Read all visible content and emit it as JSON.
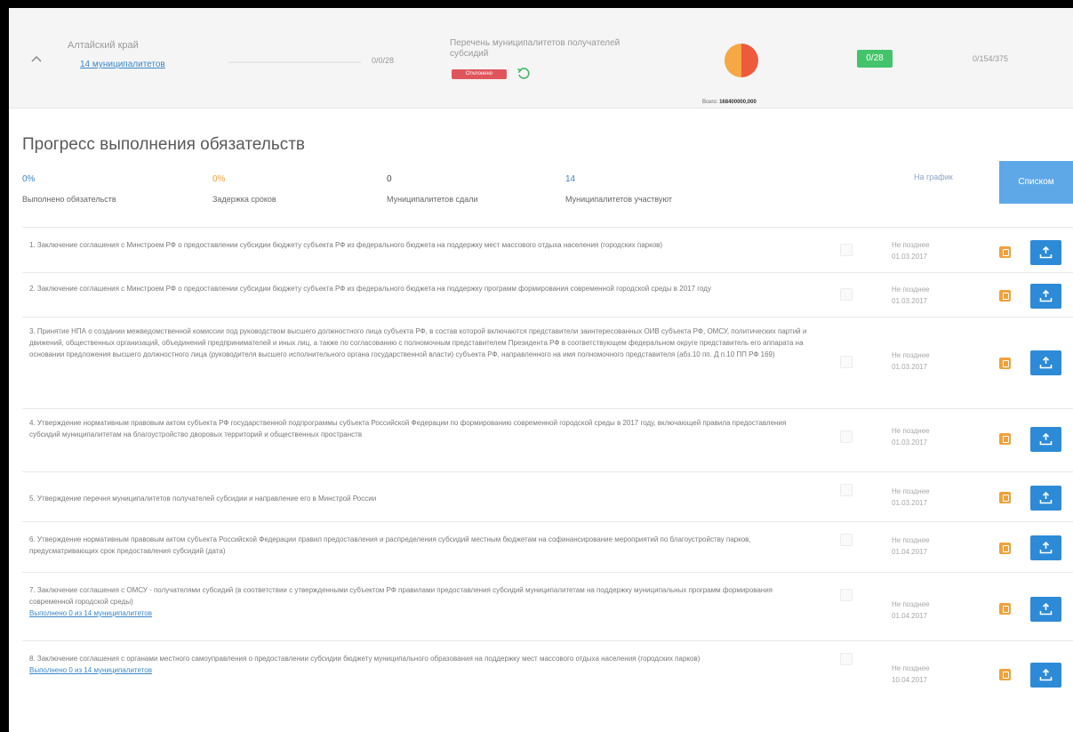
{
  "region": {
    "name": "Алтайский край",
    "municipalities_link": "14 муниципалитетов",
    "fraction": "0/0/28",
    "list_title": "Перечень муниципалитетов получателей субсидий",
    "status_badge": "Отклонено",
    "total_label": "Всего:",
    "total_value": "168400000,000",
    "percent_badge": "0/28",
    "amount": "0/154/375",
    "donut_colors": [
      "#f5a843",
      "#ee5a3c"
    ],
    "collapse_icon": "chevron-up-icon"
  },
  "progress": {
    "title": "Прогресс выполнения обязательств",
    "stats": [
      {
        "value": "0%",
        "label": "Выполнено обязательств",
        "color": "#3a87c8"
      },
      {
        "value": "0%",
        "label": "Задержка сроков",
        "color": "#f0a13b"
      },
      {
        "value": "0",
        "label": "Муниципалитетов сдали",
        "color": "#444444"
      },
      {
        "value": "14",
        "label": "Муниципалитетов участвуют",
        "color": "#3a87c8"
      }
    ],
    "chart_link": "На график",
    "list_button": "Списком"
  },
  "obligations": [
    {
      "text": "1. Заключение соглашения с Минстроем РФ о предоставлении субсидии бюджету субъекта РФ из федерального бюджета на поддержку мест массового отдыха населения (городских парков)",
      "link": "",
      "deadline_label": "Не позднее",
      "deadline_date": "01.03.2017"
    },
    {
      "text": "2. Заключение соглашения с Минстроем РФ о предоставлении субсидии бюджету субъекта РФ из федерального бюджета на поддержку программ формирования современной городской среды в 2017 году",
      "link": "",
      "deadline_label": "Не позднее",
      "deadline_date": "01.03.2017"
    },
    {
      "text": "3. Принятие НПА о создании межведомственной комиссии под руководством высшего должностного лица субъекта РФ, в состав которой включаются представители заинтересованных ОИВ субъекта РФ, ОМСУ, политических партий и движений, общественных организаций, объединений предпринимателей и иных лиц, а также по согласованию с полномочным представителем Президента РФ в соответствующем федеральном округе представитель его аппарата на основании предложения высшего должностного лица (руководителя высшего исполнительного органа государственной власти) субъекта РФ, направленного на имя полномочного представителя (абз.10 пп. Д п.10 ПП РФ 169)",
      "link": "",
      "deadline_label": "Не позднее",
      "deadline_date": "01.03.2017"
    },
    {
      "text": "4. Утверждение нормативным правовым актом субъекта РФ государственной подпрограммы субъекта Российской Федерации по формированию современной городской среды в 2017 году, включающей правила предоставления субсидий муниципалитетам на благоустройство дворовых территорий и общественных пространств",
      "link": "",
      "deadline_label": "Не позднее",
      "deadline_date": "01.03.2017"
    },
    {
      "text": "5. Утверждение перечня муниципалитетов получателей субсидии и направление его в Минстрой России",
      "link": "",
      "deadline_label": "Не позднее",
      "deadline_date": "01.03.2017"
    },
    {
      "text": "6. Утверждение нормативным правовым актом субъекта Российской Федерации правил предоставления и распределения субсидий местным бюджетам на софинансирование мероприятий по благоустройству парков, предусматривающих срок предоставления субсидий (дата)",
      "link": "",
      "deadline_label": "Не позднее",
      "deadline_date": "01.04.2017"
    },
    {
      "text": "7. Заключение соглашения с ОМСУ - получателями субсидий (в соответствии с утвержденными субъектом РФ правилами предоставления субсидий муниципалитетам на поддержку муниципальных программ формирования современной городской среды)",
      "link": "Выполнено 0 из 14 муниципалитетов",
      "deadline_label": "Не позднее",
      "deadline_date": "01.04.2017"
    },
    {
      "text": "8. Заключение соглашения с органами местного самоуправления о предоставлении субсидии бюджету муниципального образования на поддержку мест массового отдыха населения (городских парков)",
      "link": "Выполнено 0 из 14 муниципалитетов",
      "deadline_label": "Не позднее",
      "deadline_date": "10.04.2017"
    }
  ]
}
